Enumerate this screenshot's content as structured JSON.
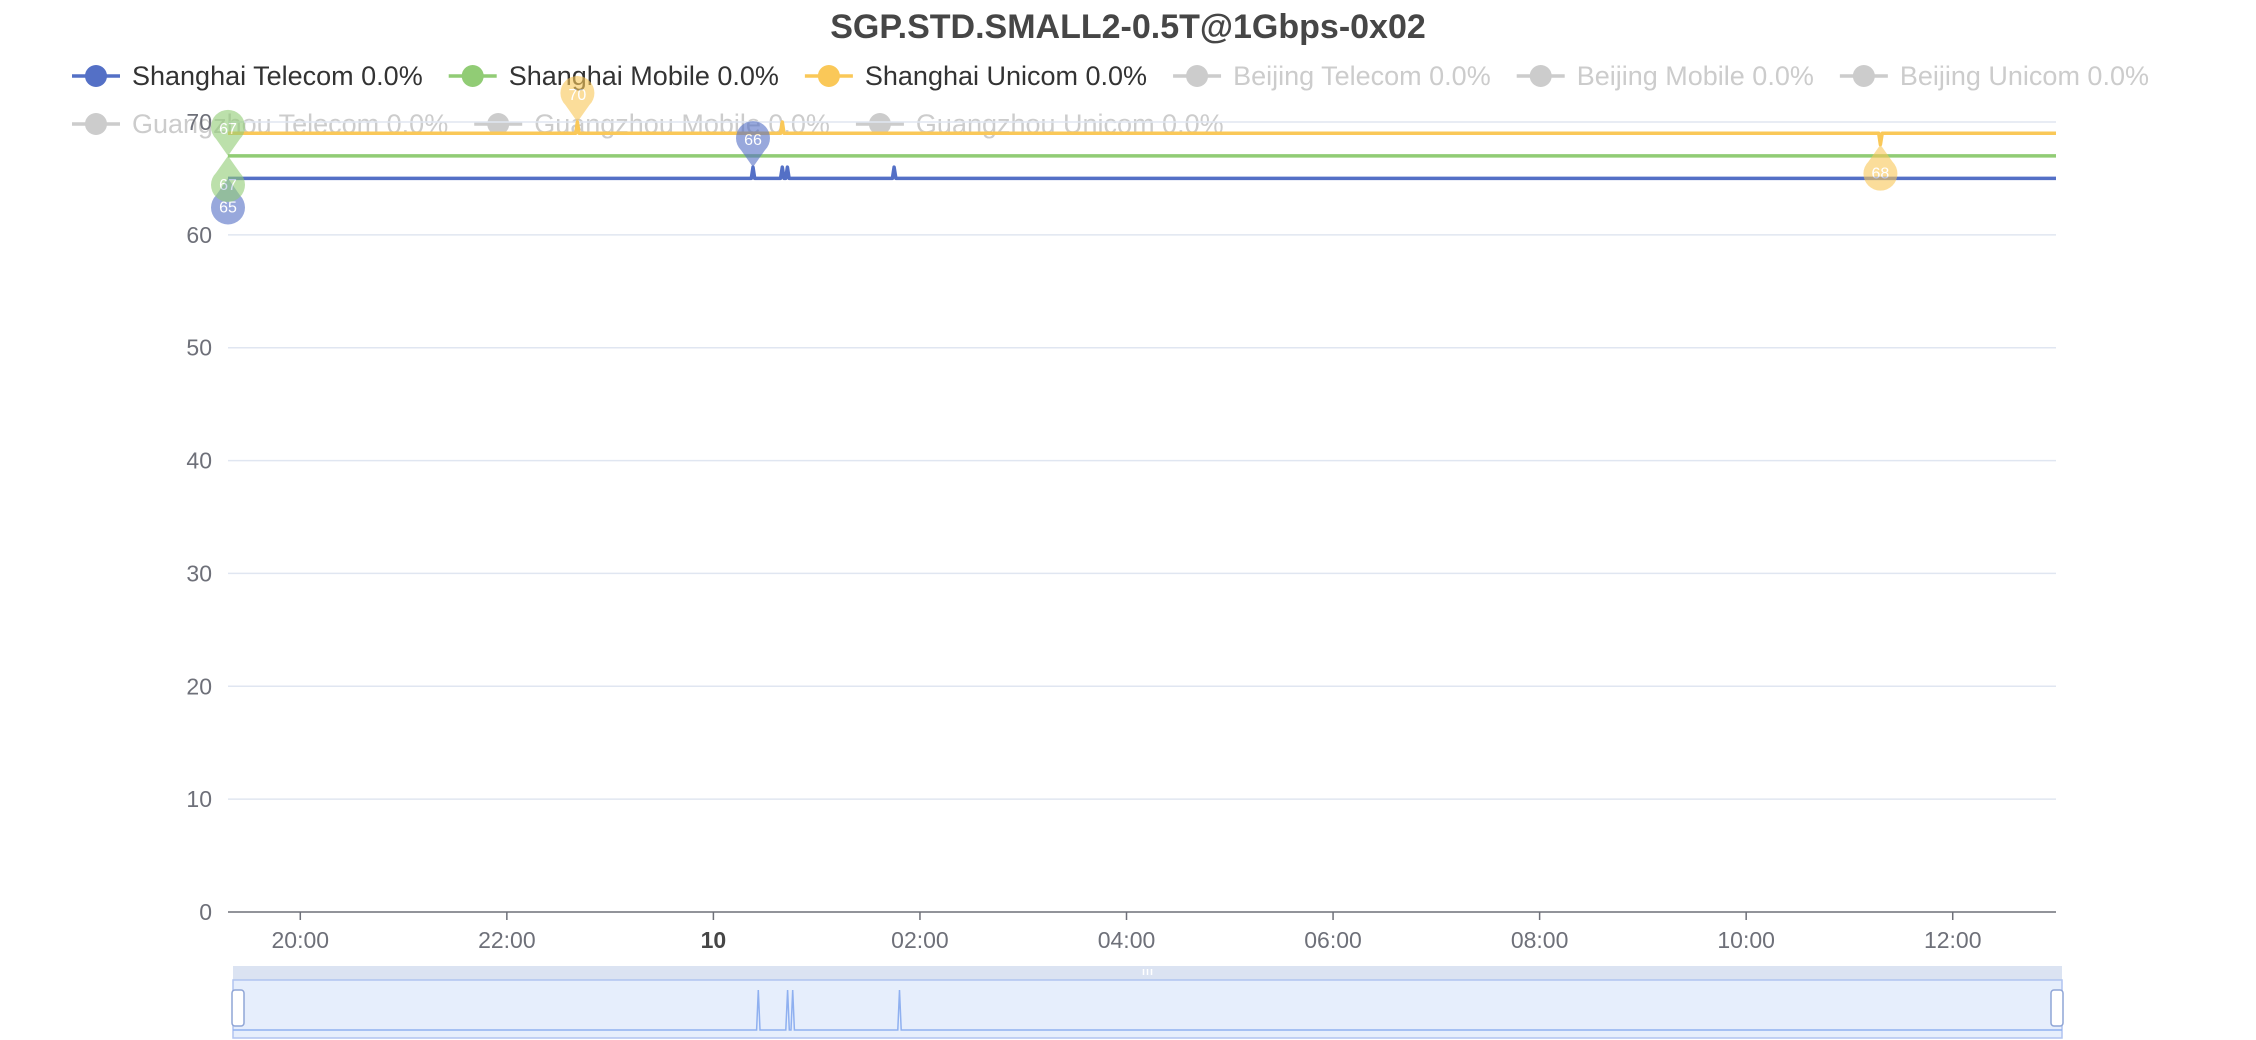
{
  "chart_data": {
    "type": "line",
    "title": "SGP.STD.SMALL2-0.5T@1Gbps-0x02",
    "xlabel": "",
    "ylabel": "",
    "ylim": [
      0,
      70
    ],
    "yticks": [
      0,
      10,
      20,
      30,
      40,
      50,
      60,
      70
    ],
    "xlim": [
      "2024-01-09T19:18",
      "2024-01-10T13:00"
    ],
    "xticks": [
      {
        "t": "2024-01-09T20:00",
        "label": "20:00",
        "bold": false
      },
      {
        "t": "2024-01-09T22:00",
        "label": "22:00",
        "bold": false
      },
      {
        "t": "2024-01-10T00:00",
        "label": "10",
        "bold": true
      },
      {
        "t": "2024-01-10T02:00",
        "label": "02:00",
        "bold": false
      },
      {
        "t": "2024-01-10T04:00",
        "label": "04:00",
        "bold": false
      },
      {
        "t": "2024-01-10T06:00",
        "label": "06:00",
        "bold": false
      },
      {
        "t": "2024-01-10T08:00",
        "label": "08:00",
        "bold": false
      },
      {
        "t": "2024-01-10T10:00",
        "label": "10:00",
        "bold": false
      },
      {
        "t": "2024-01-10T12:00",
        "label": "12:00",
        "bold": false
      }
    ],
    "grid": true,
    "legend_position": "top",
    "series": [
      {
        "name": "Shanghai Telecom 0.0%",
        "color": "#5470c6",
        "active": true,
        "points": [
          [
            "2024-01-09T19:18",
            65
          ],
          [
            "2024-01-10T00:22",
            65
          ],
          [
            "2024-01-10T00:23",
            66
          ],
          [
            "2024-01-10T00:24",
            65
          ],
          [
            "2024-01-10T00:39",
            65
          ],
          [
            "2024-01-10T00:40",
            66
          ],
          [
            "2024-01-10T00:41",
            65
          ],
          [
            "2024-01-10T00:42",
            65
          ],
          [
            "2024-01-10T00:43",
            66
          ],
          [
            "2024-01-10T00:44",
            65
          ],
          [
            "2024-01-10T01:44",
            65
          ],
          [
            "2024-01-10T01:45",
            66
          ],
          [
            "2024-01-10T01:46",
            65
          ],
          [
            "2024-01-10T13:00",
            65
          ]
        ],
        "markers": [
          {
            "label": "65",
            "t": "2024-01-09T19:18",
            "v": 65,
            "kind": "min"
          },
          {
            "label": "66",
            "t": "2024-01-10T00:23",
            "v": 66,
            "kind": "max"
          }
        ]
      },
      {
        "name": "Shanghai Mobile 0.0%",
        "color": "#91cc75",
        "active": true,
        "points": [
          [
            "2024-01-09T19:18",
            67
          ],
          [
            "2024-01-10T13:00",
            67
          ]
        ],
        "markers": [
          {
            "label": "67",
            "t": "2024-01-09T19:18",
            "v": 67,
            "kind": "min"
          },
          {
            "label": "67",
            "t": "2024-01-09T19:18",
            "v": 67,
            "kind": "max"
          }
        ]
      },
      {
        "name": "Shanghai Unicom 0.0%",
        "color": "#fac858",
        "active": true,
        "points": [
          [
            "2024-01-09T19:18",
            69
          ],
          [
            "2024-01-09T22:40",
            69
          ],
          [
            "2024-01-09T22:41",
            70
          ],
          [
            "2024-01-09T22:42",
            69
          ],
          [
            "2024-01-10T00:39",
            69
          ],
          [
            "2024-01-10T00:40",
            70
          ],
          [
            "2024-01-10T00:41",
            69
          ],
          [
            "2024-01-10T11:17",
            69
          ],
          [
            "2024-01-10T11:18",
            68
          ],
          [
            "2024-01-10T11:19",
            69
          ],
          [
            "2024-01-10T13:00",
            69
          ]
        ],
        "markers": [
          {
            "label": "70",
            "t": "2024-01-09T22:41",
            "v": 70,
            "kind": "max"
          },
          {
            "label": "68",
            "t": "2024-01-10T11:18",
            "v": 68,
            "kind": "min"
          }
        ]
      },
      {
        "name": "Beijing Telecom 0.0%",
        "color": "#cccccc",
        "active": false,
        "points": [],
        "markers": []
      },
      {
        "name": "Beijing Mobile 0.0%",
        "color": "#cccccc",
        "active": false,
        "points": [],
        "markers": []
      },
      {
        "name": "Beijing Unicom 0.0%",
        "color": "#cccccc",
        "active": false,
        "points": [],
        "markers": []
      },
      {
        "name": "Guangzhou Telecom 0.0%",
        "color": "#cccccc",
        "active": false,
        "points": [],
        "markers": []
      },
      {
        "name": "Guangzhou Mobile 0.0%",
        "color": "#cccccc",
        "active": false,
        "points": [],
        "markers": []
      },
      {
        "name": "Guangzhou Unicom 0.0%",
        "color": "#cccccc",
        "active": false,
        "points": [],
        "markers": []
      }
    ],
    "data_zoom": {
      "start": 0,
      "end": 100
    }
  }
}
